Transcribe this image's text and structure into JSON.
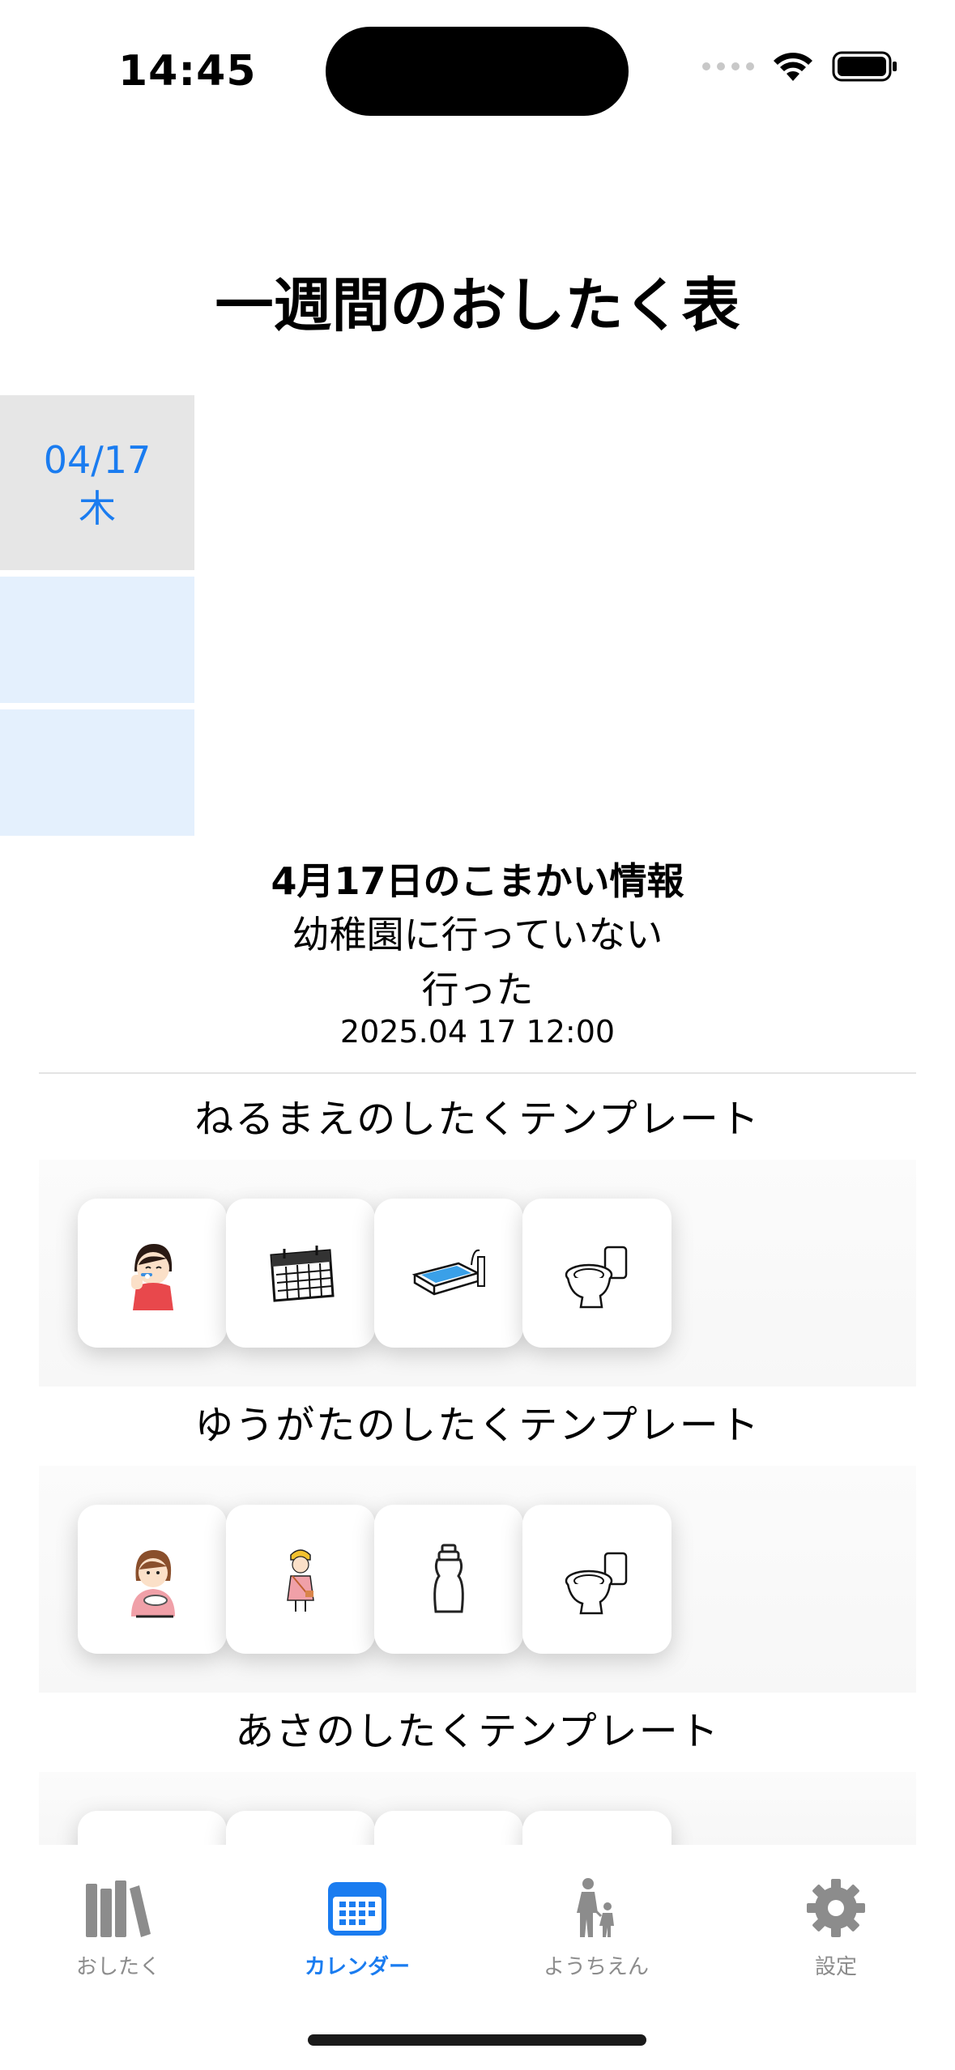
{
  "status_bar": {
    "time": "14:45"
  },
  "page_title": "一週間のおしたく表",
  "days": [
    {
      "date": "04/17",
      "weekday": "木",
      "selected": true
    },
    {
      "date": "",
      "weekday": "",
      "selected": false
    },
    {
      "date": "",
      "weekday": "",
      "selected": false
    }
  ],
  "detail": {
    "title": "4月17日のこまかい情報",
    "line1": "幼稚園に行っていない",
    "line2": "行った",
    "timestamp": "2025.04 17 12:00"
  },
  "templates": [
    {
      "title": "ねるまえのしたくテンプレート",
      "icons": [
        "tooth-brushing-girl-icon",
        "calendar-icon",
        "bathtub-icon",
        "toilet-icon"
      ]
    },
    {
      "title": "ゆうがたのしたくテンプレート",
      "icons": [
        "eating-girl-icon",
        "kindergarten-child-icon",
        "water-bottle-icon",
        "toilet-icon"
      ]
    },
    {
      "title": "あさのしたくテンプレート",
      "icons": []
    }
  ],
  "tabbar": {
    "items": [
      {
        "label": "おしたく",
        "icon": "books-icon",
        "active": false
      },
      {
        "label": "カレンダー",
        "icon": "calendar-icon",
        "active": true
      },
      {
        "label": "ようちえん",
        "icon": "parent-child-icon",
        "active": false
      },
      {
        "label": "設定",
        "icon": "gear-icon",
        "active": false
      }
    ]
  },
  "colors": {
    "accent": "#1a7cf0",
    "selected_day_bg": "#e6e6e6",
    "day_bg": "#e4f0fd"
  }
}
